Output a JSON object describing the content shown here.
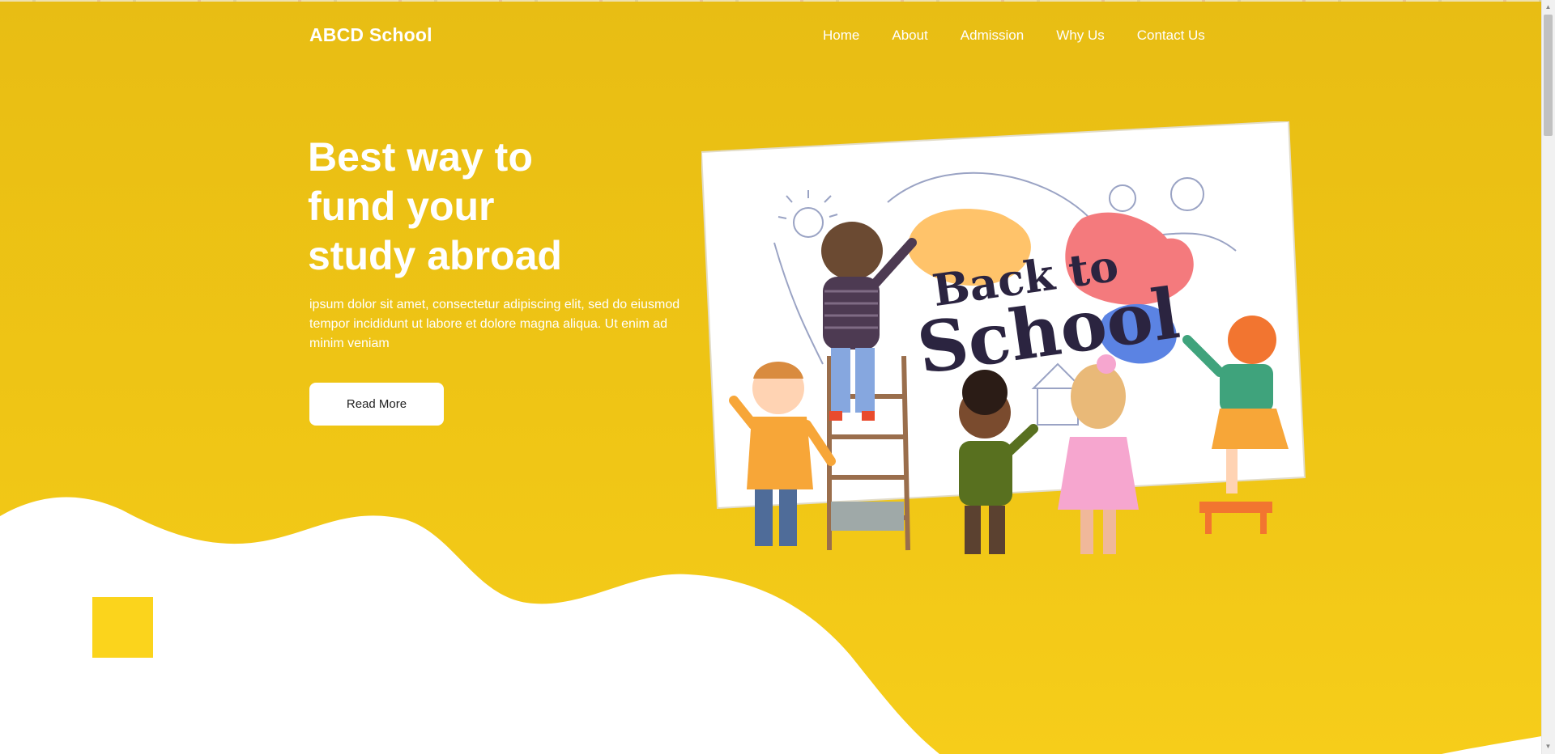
{
  "brand": {
    "name": "ABCD School"
  },
  "nav": {
    "items": [
      {
        "label": "Home"
      },
      {
        "label": "About"
      },
      {
        "label": "Admission"
      },
      {
        "label": "Why Us"
      },
      {
        "label": "Contact Us"
      }
    ]
  },
  "hero": {
    "title_lines": [
      "Best way to",
      "fund your",
      "study abroad"
    ],
    "description": "ipsum dolor sit amet, consectetur adipiscing elit, sed do eiusmod tempor incididunt ut labore et dolore magna aliqua. Ut enim ad minim veniam",
    "button_label": "Read More"
  },
  "illustration": {
    "line1": "Back to",
    "line2": "School"
  },
  "colors": {
    "primary_yellow": "#efc515",
    "accent_square": "#fbd41c",
    "text_white": "#ffffff",
    "illustration_navy": "#2b2440"
  }
}
